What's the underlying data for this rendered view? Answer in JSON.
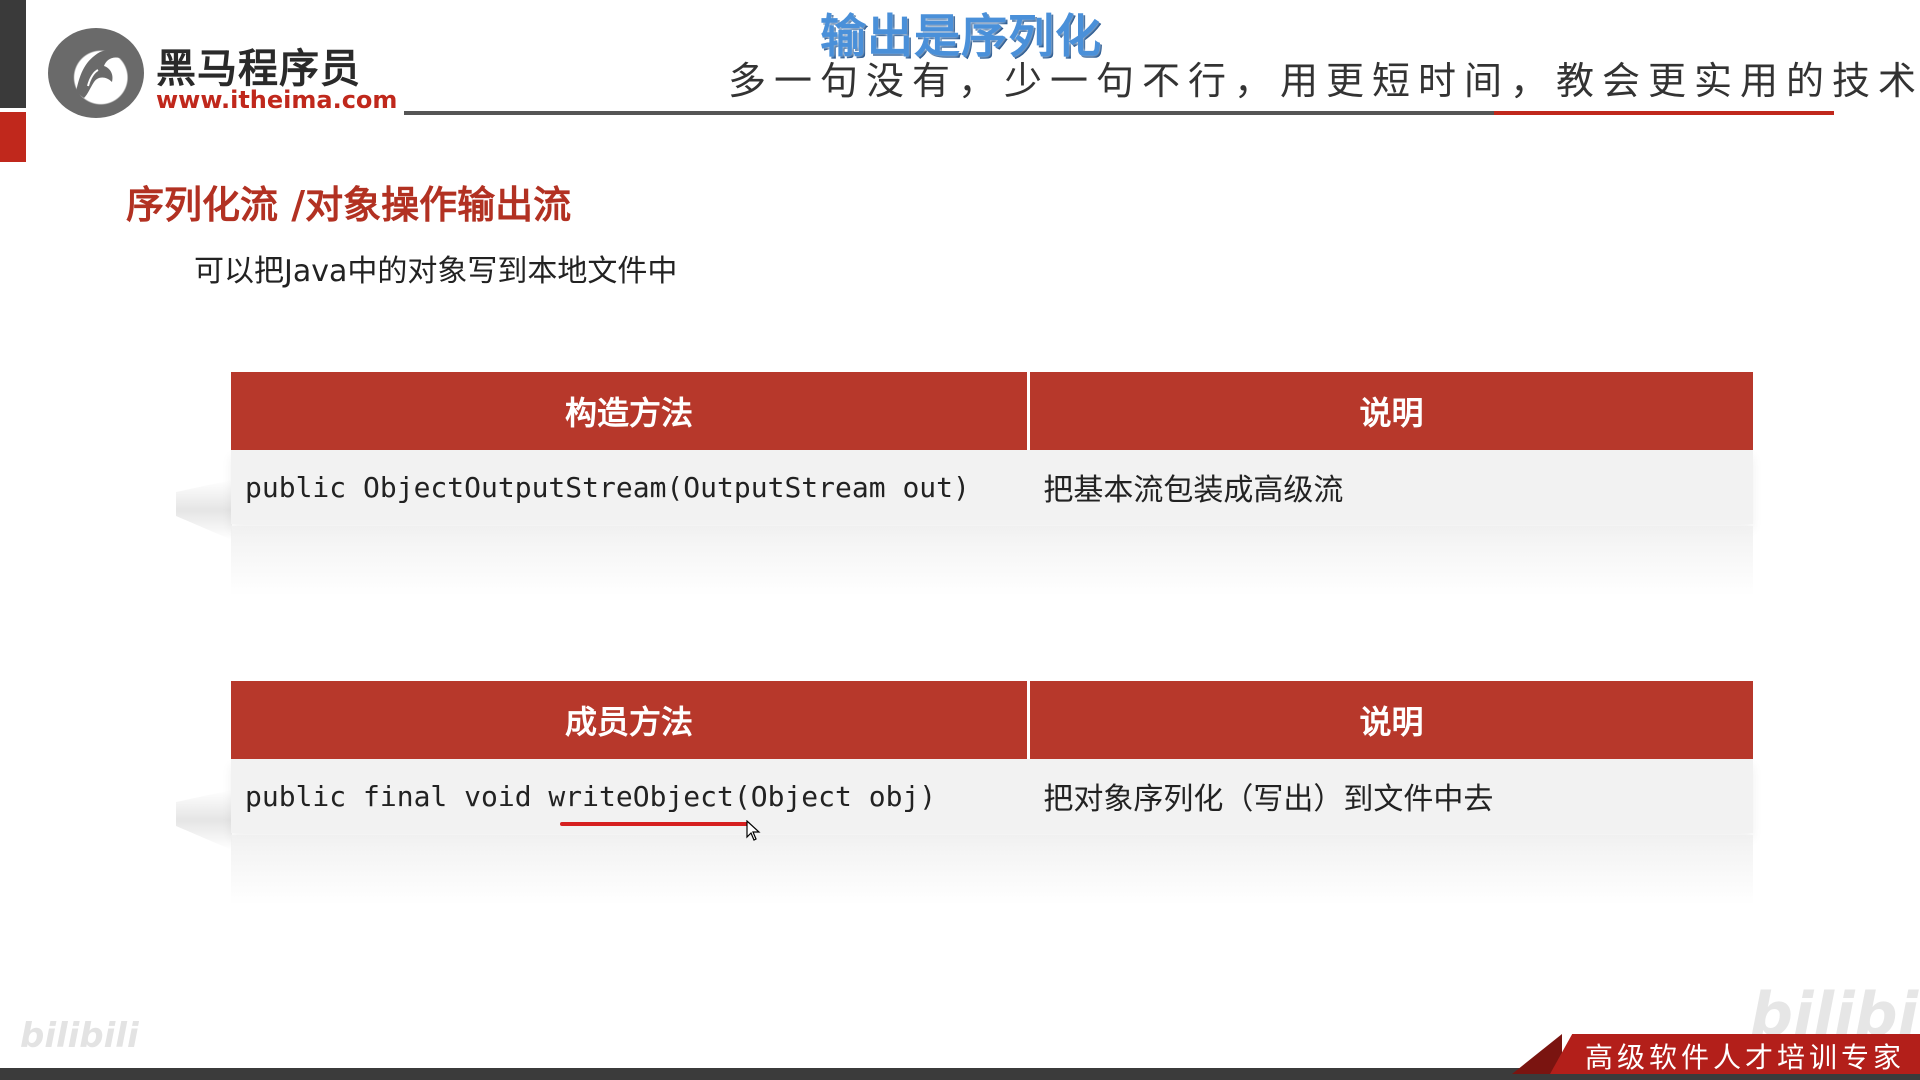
{
  "header": {
    "overlay_title": "输出是序列化",
    "slogan": "多一句没有，少一句不行，用更短时间，教会更实用的技术!"
  },
  "logo": {
    "name": "黑马程序员",
    "url": "www.itheima.com",
    "icon": "horse-head-logo-icon"
  },
  "section": {
    "title": "序列化流 /对象操作输出流",
    "description": "可以把Java中的对象写到本地文件中"
  },
  "constructor_table": {
    "headers": [
      "构造方法",
      "说明"
    ],
    "rows": [
      {
        "method": "public ObjectOutputStream(OutputStream out)",
        "desc": "把基本流包装成高级流"
      }
    ]
  },
  "member_table": {
    "headers": [
      "成员方法",
      "说明"
    ],
    "rows": [
      {
        "method": "public final void writeObject(Object obj)",
        "desc": "把对象序列化（写出）到文件中去"
      }
    ]
  },
  "footer": {
    "badge_text": "高级软件人才培训专家",
    "watermark_left": "bilibili",
    "watermark_right": "bilibili"
  },
  "colors": {
    "accent_red": "#b7382b",
    "title_red": "#b23122",
    "overlay_blue": "#4a90d9",
    "dark_gray": "#3a3a3a"
  }
}
